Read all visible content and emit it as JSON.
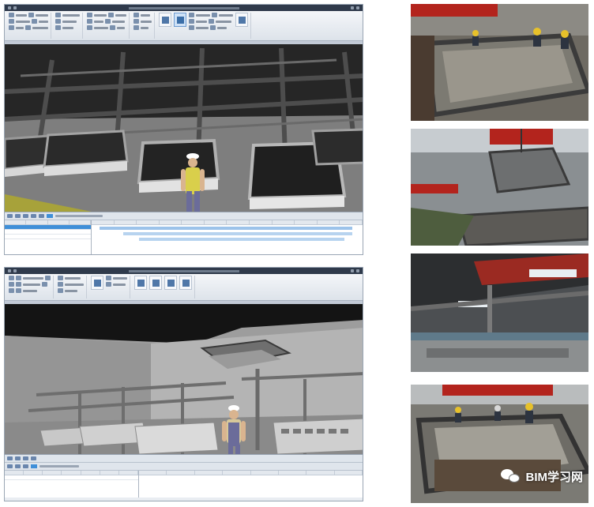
{
  "watermark": {
    "text": "BIM学习网",
    "icon": "wechat-icon"
  },
  "screens": [
    {
      "id": "navisworks-top",
      "ribbon_icons": 14,
      "timeliner_rows": 3
    },
    {
      "id": "navisworks-bottom",
      "ribbon_icons": 12,
      "timeliner_rows": 1
    }
  ],
  "photos": [
    {
      "name": "site-photo-1"
    },
    {
      "name": "site-photo-2"
    },
    {
      "name": "site-photo-3"
    },
    {
      "name": "site-photo-4"
    }
  ],
  "colors": {
    "viewport_floor_top": "#7f7f7f",
    "viewport_bg_top": "#1e1e1e",
    "viewport_bg_bottom": "#9d9d9d",
    "banner_red": "#b3241d",
    "selection_blue": "#3f8fd8",
    "worker_vest": "#d9cf4b",
    "worker_pants": "#6b6c9a"
  }
}
